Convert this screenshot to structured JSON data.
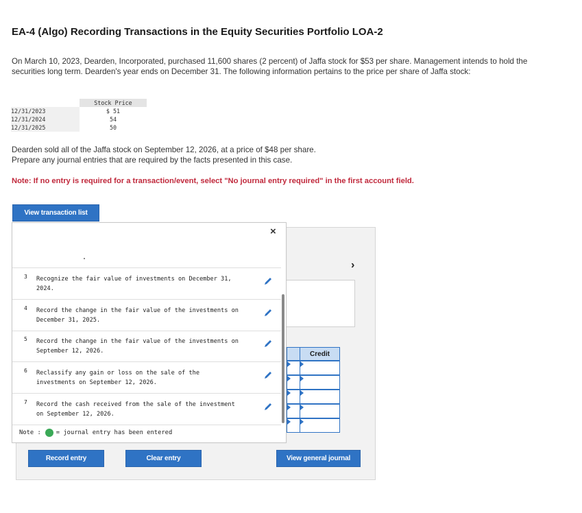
{
  "title": "EA-4 (Algo) Recording Transactions in the Equity Securities Portfolio LOA-2",
  "intro": "On March 10, 2023, Dearden, Incorporated, purchased 11,600 shares (2 percent) of Jaffa stock for $53 per share. Management intends to hold the securities long term. Dearden's year ends on December 31. The following information pertains to the price per share of Jaffa stock:",
  "price_table": {
    "header": "Stock Price",
    "rows": [
      {
        "date": "12/31/2023",
        "price": "$ 51"
      },
      {
        "date": "12/31/2024",
        "price": "54"
      },
      {
        "date": "12/31/2025",
        "price": "50"
      }
    ]
  },
  "sold_line1": "Dearden sold all of the Jaffa stock on September 12, 2026, at a price of $48 per share.",
  "sold_line2": "Prepare any journal entries that are required by the facts presented in this case.",
  "note_red": "Note: If no entry is required for a transaction/event, select \"No journal entry required\" in the first account field.",
  "buttons": {
    "view_transaction_list": "View transaction list",
    "record_entry": "Record entry",
    "clear_entry": "Clear entry",
    "view_general_journal": "View general journal"
  },
  "close_icon": "×",
  "chevron_icon": "›",
  "journal": {
    "credit_header": "Credit"
  },
  "transactions": [
    {
      "num": "3",
      "desc": "Recognize the fair value of investments on December 31, 2024."
    },
    {
      "num": "4",
      "desc": "Record the change in the fair value of the investments on December 31, 2025."
    },
    {
      "num": "5",
      "desc": "Record the change in the fair value of the investments on September 12, 2026."
    },
    {
      "num": "6",
      "desc": "Reclassify any gain or loss on the sale of the investments on September 12, 2026."
    },
    {
      "num": "7",
      "desc": "Record the cash received from the sale of the investment on September 12, 2026."
    }
  ],
  "note_line": {
    "prefix": "Note :",
    "suffix": "= journal entry has been entered"
  },
  "colors": {
    "accent": "#2f73c4",
    "note_red": "#c0283b",
    "entered_green": "#3aa957"
  }
}
